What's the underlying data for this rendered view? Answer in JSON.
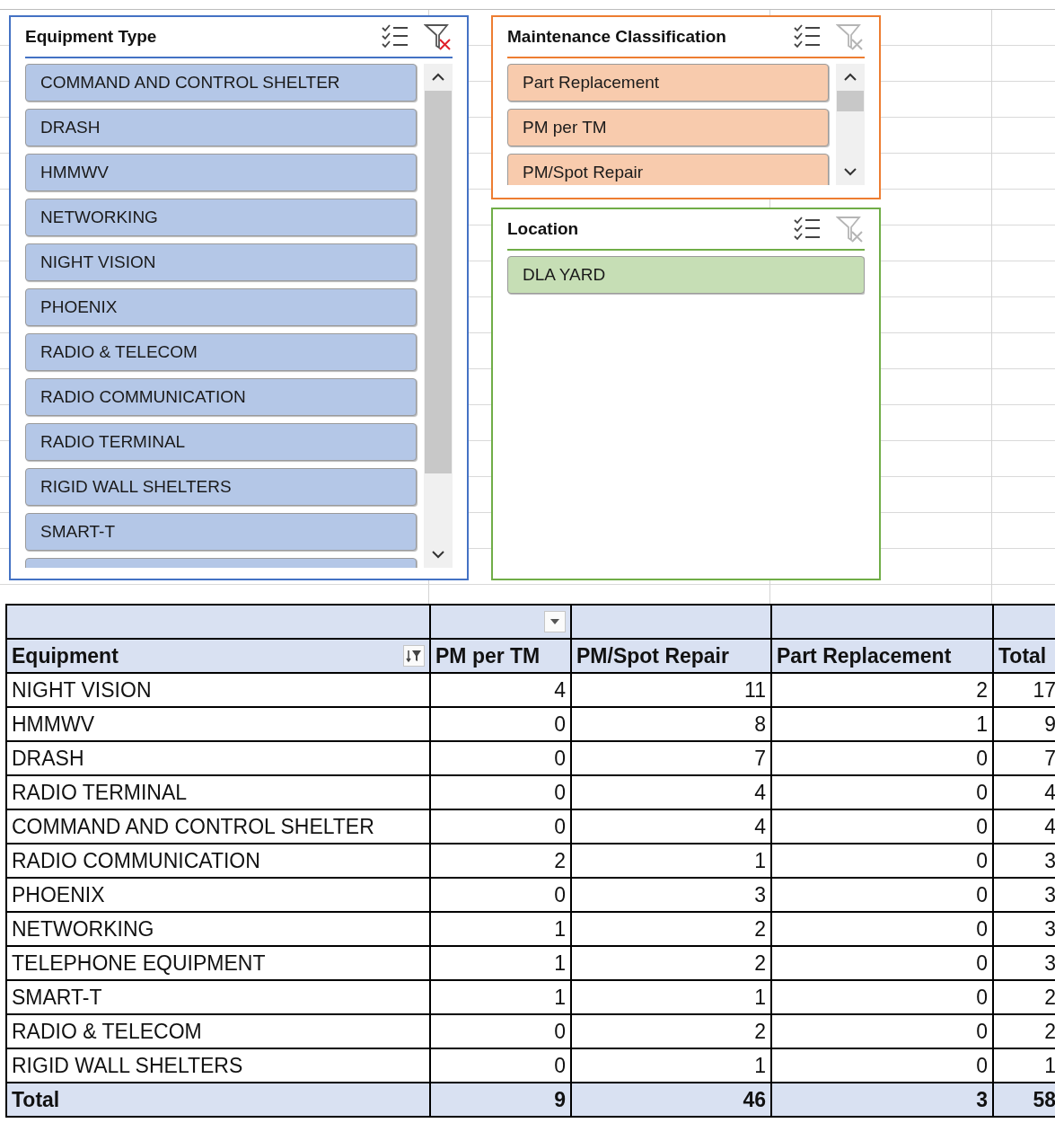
{
  "slicers": [
    {
      "title": "Equipment Type",
      "color": "#4472c4",
      "filter_active": true,
      "scrollbar": true,
      "more_below": true,
      "items": [
        {
          "label": "COMMAND AND CONTROL SHELTER",
          "selected": true
        },
        {
          "label": "DRASH",
          "selected": true
        },
        {
          "label": "HMMWV",
          "selected": true
        },
        {
          "label": "NETWORKING",
          "selected": true
        },
        {
          "label": "NIGHT VISION",
          "selected": true
        },
        {
          "label": "PHOENIX",
          "selected": true
        },
        {
          "label": "RADIO & TELECOM",
          "selected": true
        },
        {
          "label": "RADIO COMMUNICATION",
          "selected": true
        },
        {
          "label": "RADIO TERMINAL",
          "selected": true
        },
        {
          "label": "RIGID WALL SHELTERS",
          "selected": true
        },
        {
          "label": "SMART-T",
          "selected": true
        }
      ]
    },
    {
      "title": "Maintenance Classification",
      "color": "#ed7d31",
      "filter_active": false,
      "scrollbar": true,
      "more_below": false,
      "items": [
        {
          "label": "Part Replacement",
          "selected": true
        },
        {
          "label": "PM per TM",
          "selected": true
        },
        {
          "label": "PM/Spot Repair",
          "selected": true
        }
      ]
    },
    {
      "title": "Location",
      "color": "#70ad47",
      "filter_active": false,
      "scrollbar": false,
      "more_below": false,
      "items": [
        {
          "label": "DLA YARD",
          "selected": true
        }
      ]
    }
  ],
  "pivot": {
    "columns": [
      "Equipment",
      "PM per TM",
      "PM/Spot Repair",
      "Part Replacement",
      "Total"
    ],
    "rows": [
      [
        "NIGHT VISION",
        "4",
        "11",
        "2",
        "17"
      ],
      [
        "HMMWV",
        "0",
        "8",
        "1",
        "9"
      ],
      [
        "DRASH",
        "0",
        "7",
        "0",
        "7"
      ],
      [
        "RADIO TERMINAL",
        "0",
        "4",
        "0",
        "4"
      ],
      [
        "COMMAND AND CONTROL SHELTER",
        "0",
        "4",
        "0",
        "4"
      ],
      [
        "RADIO COMMUNICATION",
        "2",
        "1",
        "0",
        "3"
      ],
      [
        "PHOENIX",
        "0",
        "3",
        "0",
        "3"
      ],
      [
        "NETWORKING",
        "1",
        "2",
        "0",
        "3"
      ],
      [
        "TELEPHONE EQUIPMENT",
        "1",
        "2",
        "0",
        "3"
      ],
      [
        "SMART-T",
        "1",
        "1",
        "0",
        "2"
      ],
      [
        "RADIO & TELECOM",
        "0",
        "2",
        "0",
        "2"
      ],
      [
        "RIGID WALL SHELTERS",
        "0",
        "1",
        "0",
        "1"
      ]
    ],
    "total": [
      "Total",
      "9",
      "46",
      "3",
      "58"
    ]
  }
}
